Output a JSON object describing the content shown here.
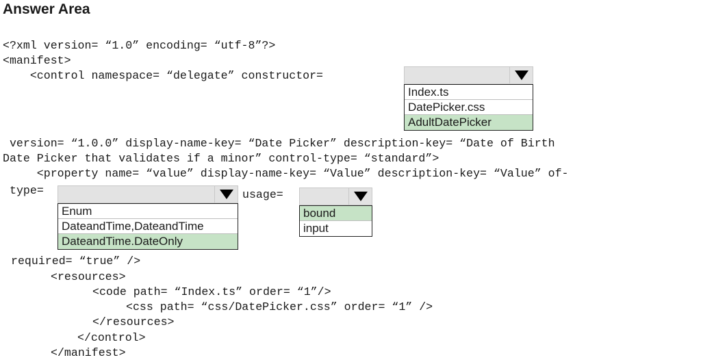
{
  "header": {
    "title": "Answer Area"
  },
  "code_lines": {
    "l1": "<?xml version= “1.0” encoding= “utf-8”?>",
    "l2": "<manifest>",
    "l3": "    <control namespace= “delegate” constructor=",
    "l4": " version= “1.0.0” display-name-key= “Date Picker” description-key= “Date of Birth",
    "l5": "Date Picker that validates if a minor” control-type= “standard”>",
    "l6": "     <property name= “value” display-name-key= “Value” description-key= “Value” of-",
    "l7": "type=",
    "l7b": "usage=",
    "l8": "required= “true” />",
    "l9": "<resources>",
    "l10": "<code path= “Index.ts” order= “1”/>",
    "l11": "<css path= “css/DatePicker.css” order= “1” />",
    "l12": "</resources>",
    "l13": "</control>",
    "l14": "</manifest>"
  },
  "dropdowns": {
    "constructor": {
      "selected": "",
      "options": [
        "Index.ts",
        "DatePicker.css",
        "AdultDatePicker"
      ],
      "highlighted": "AdultDatePicker"
    },
    "type": {
      "selected": "",
      "options": [
        "Enum",
        "DateandTime,DateandTime",
        "DateandTime.DateOnly"
      ],
      "highlighted": "DateandTime.DateOnly"
    },
    "usage": {
      "selected": "",
      "options": [
        "bound",
        "input"
      ],
      "highlighted": "bound"
    }
  },
  "colors": {
    "highlight": "#c6e3c6",
    "dropdown_bg": "#e3e3e3"
  }
}
